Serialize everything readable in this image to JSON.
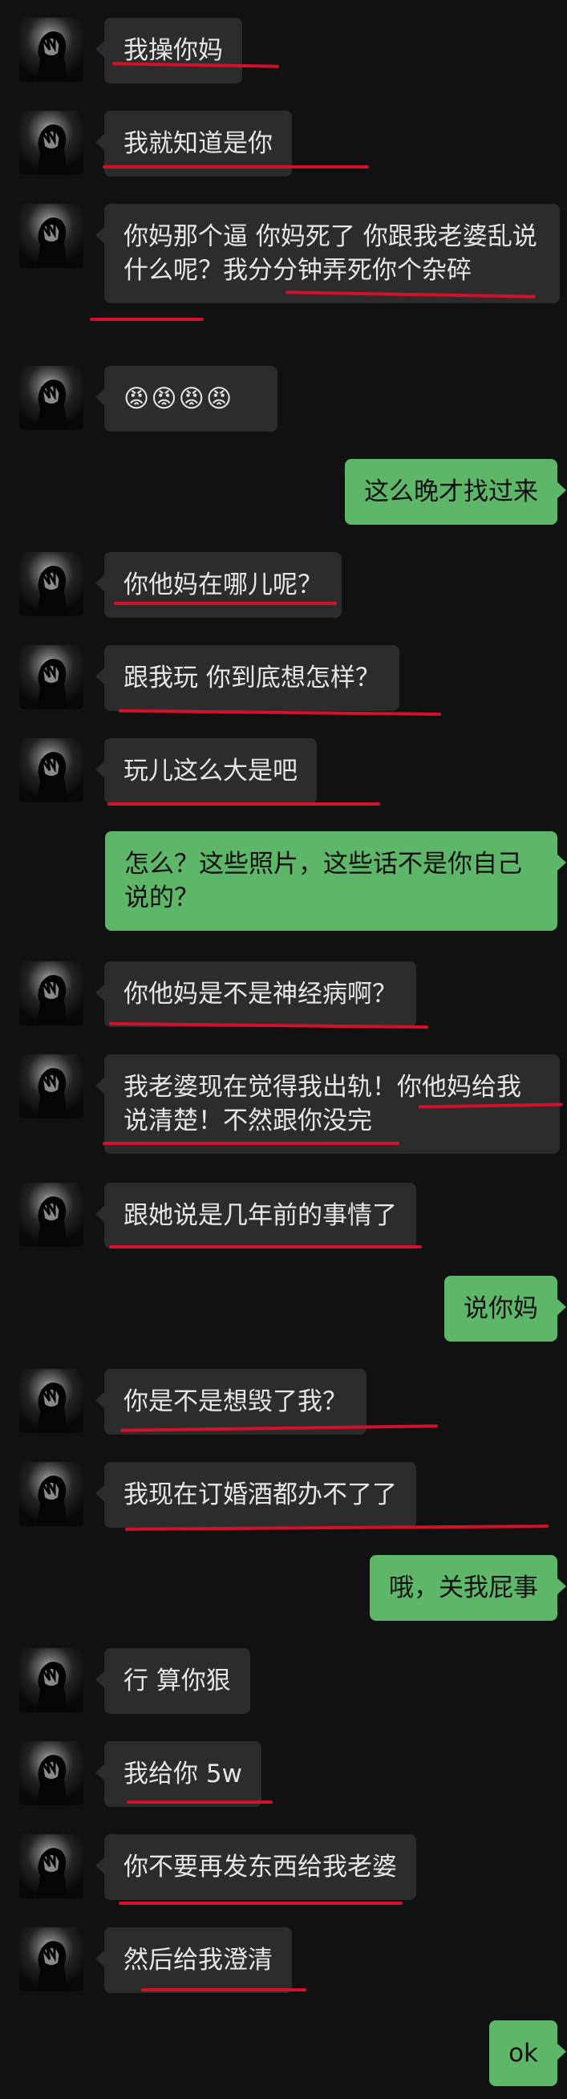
{
  "colors": {
    "background": "#111111",
    "incoming_bubble": "#2c2c2c",
    "outgoing_bubble": "#5eb669",
    "annotation_underline": "#d5102a"
  },
  "messages": [
    {
      "side": "in",
      "text": "我操你妈"
    },
    {
      "side": "in",
      "text": "我就知道是你"
    },
    {
      "side": "in",
      "text": "你妈那个逼 你妈死了 你跟我老婆乱说什么呢？我分分钟弄死你个杂碎"
    },
    {
      "side": "in",
      "text": "😡😡😡😡"
    },
    {
      "side": "out",
      "text": "这么晚才找过来"
    },
    {
      "side": "in",
      "text": "你他妈在哪儿呢？"
    },
    {
      "side": "in",
      "text": "跟我玩 你到底想怎样？"
    },
    {
      "side": "in",
      "text": "玩儿这么大是吧"
    },
    {
      "side": "out",
      "text": "怎么？这些照片，这些话不是你自己说的？"
    },
    {
      "side": "in",
      "text": "你他妈是不是神经病啊？"
    },
    {
      "side": "in",
      "text": "我老婆现在觉得我出轨！你他妈给我说清楚！不然跟你没完"
    },
    {
      "side": "in",
      "text": "跟她说是几年前的事情了"
    },
    {
      "side": "out",
      "text": "说你妈"
    },
    {
      "side": "in",
      "text": "你是不是想毁了我？"
    },
    {
      "side": "in",
      "text": "我现在订婚酒都办不了了"
    },
    {
      "side": "out",
      "text": "哦，关我屁事"
    },
    {
      "side": "in",
      "text": "行 算你狠"
    },
    {
      "side": "in",
      "text": "我给你 5w"
    },
    {
      "side": "in",
      "text": "你不要再发东西给我老婆"
    },
    {
      "side": "in",
      "text": "然后给我澄清"
    },
    {
      "side": "out",
      "text": "ok"
    }
  ]
}
